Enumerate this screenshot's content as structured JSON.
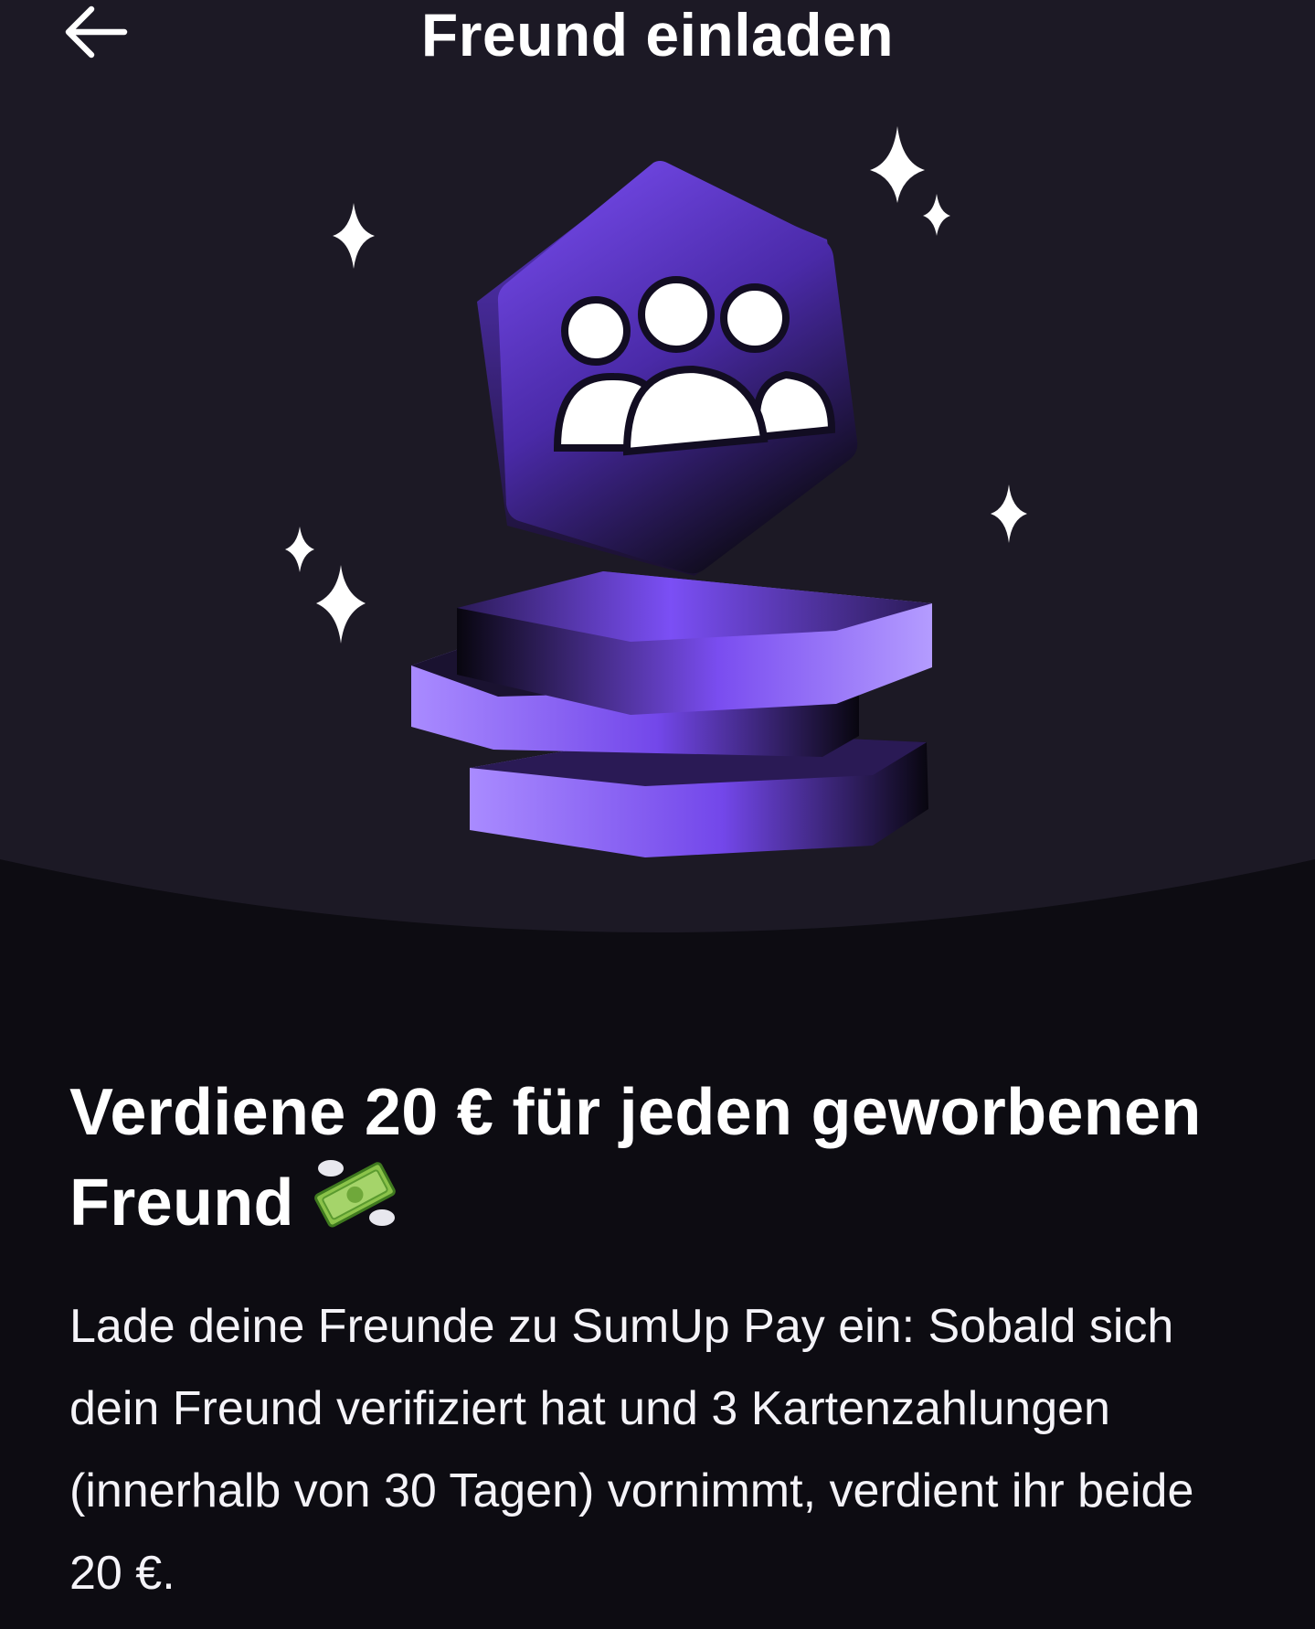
{
  "header": {
    "title": "Freund einladen",
    "back_icon": "arrow-left-icon"
  },
  "illustration": {
    "subject": "people-group-icon",
    "decorations": "sparkle-icon",
    "accent_color": "#7a4df0"
  },
  "main": {
    "headline": "Verdiene 20 € für jeden geworbenen Freund",
    "headline_emoji_icon": "money-with-wings-icon",
    "description": "Lade deine Freunde zu SumUp Pay ein: Sobald sich dein Freund verifiziert hat und 3 Kartenzahlungen (innerhalb von 30 Tagen) vornimmt, verdient ihr beide 20 €."
  },
  "colors": {
    "background": "#0d0c12",
    "hero_background": "#1c1925",
    "accent": "#7a4df0",
    "accent_light": "#a98bff",
    "text": "#ffffff"
  }
}
